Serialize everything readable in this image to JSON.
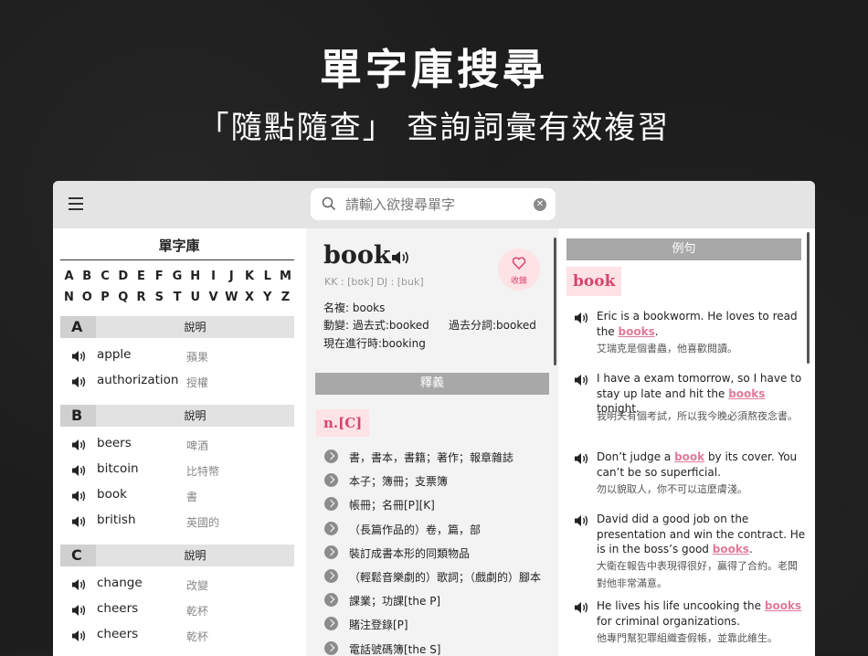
{
  "promo": {
    "title": "單字庫搜尋",
    "subtitle": "「隨點隨查」 查詢詞彙有效複習"
  },
  "search": {
    "placeholder": "請輸入欲搜尋單字"
  },
  "wordbank": {
    "title": "單字庫",
    "alphabet_row1": [
      "A",
      "B",
      "C",
      "D",
      "E",
      "F",
      "G",
      "H",
      "I",
      "J",
      "K",
      "L",
      "M"
    ],
    "alphabet_row2": [
      "N",
      "O",
      "P",
      "Q",
      "R",
      "S",
      "T",
      "U",
      "V",
      "W",
      "X",
      "Y",
      "Z"
    ],
    "desc_label": "說明",
    "sections": [
      {
        "letter": "A",
        "words": [
          {
            "word": "apple",
            "meaning": "蘋果"
          },
          {
            "word": "authorization",
            "meaning": "授權"
          }
        ]
      },
      {
        "letter": "B",
        "words": [
          {
            "word": "beers",
            "meaning": "啤酒"
          },
          {
            "word": "bitcoin",
            "meaning": "比特幣"
          },
          {
            "word": "book",
            "meaning": "書"
          },
          {
            "word": "british",
            "meaning": "英國的"
          }
        ]
      },
      {
        "letter": "C",
        "words": [
          {
            "word": "change",
            "meaning": "改變"
          },
          {
            "word": "cheers",
            "meaning": "乾杯"
          },
          {
            "word": "cheers",
            "meaning": "乾杯"
          }
        ]
      }
    ]
  },
  "entry": {
    "headword": "book",
    "pronunciation": "KK : [bʊk]  DJ : [buk]",
    "favorite_label": "收錄",
    "plural": "名複: books",
    "past": "動變: 過去式:booked",
    "past_participle": "過去分詞:booked",
    "present_participle": "現在進行時:booking",
    "definitions_header": "釋義",
    "pos": "n.[C]",
    "definitions": [
      "書，書本，書籍；著作；報章雜誌",
      "本子；簿冊；支票簿",
      "帳冊；名冊[P][K]",
      "（長篇作品的）卷，篇，部",
      "裝訂成書本形的同類物品",
      "（輕鬆音樂劇的）歌詞；（戲劇的）腳本",
      "課業；功課[the P]",
      "賭注登錄[P]",
      "電話號碼簿[the S]"
    ]
  },
  "examples": {
    "header": "例句",
    "word": "book",
    "items": [
      {
        "en": [
          "Eric is a bookworm. He loves to read the ",
          "books",
          "."
        ],
        "zh": "艾瑞克是個書蟲，他喜歡閱讀。"
      },
      {
        "en": [
          "I have a exam tomorrow, so I have to stay up late and hit the ",
          "books",
          " tonight."
        ],
        "zh": "我明天有個考試，所以我今晚必須熬夜念書。"
      },
      {
        "en": [
          "Don’t judge a ",
          "book",
          " by its cover. You can’t be so superficial."
        ],
        "zh": "勿以貌取人，你不可以這麼膚淺。"
      },
      {
        "en": [
          "David did a good job on the presentation and win the contract. He is in the boss’s good ",
          "books",
          "."
        ],
        "zh": "大衛在報告中表現得很好，贏得了合約。老闆對他非常滿意。"
      },
      {
        "en": [
          "He lives his life uncooking the ",
          "books",
          " for criminal organizations."
        ],
        "zh": "他專門幫犯罪組織查假帳，並靠此維生。"
      }
    ]
  },
  "colors": {
    "accent": "#d8456a",
    "accent_bg": "#fde2e6",
    "highlight": "#e07a98",
    "bar": "#a8a8a8"
  }
}
